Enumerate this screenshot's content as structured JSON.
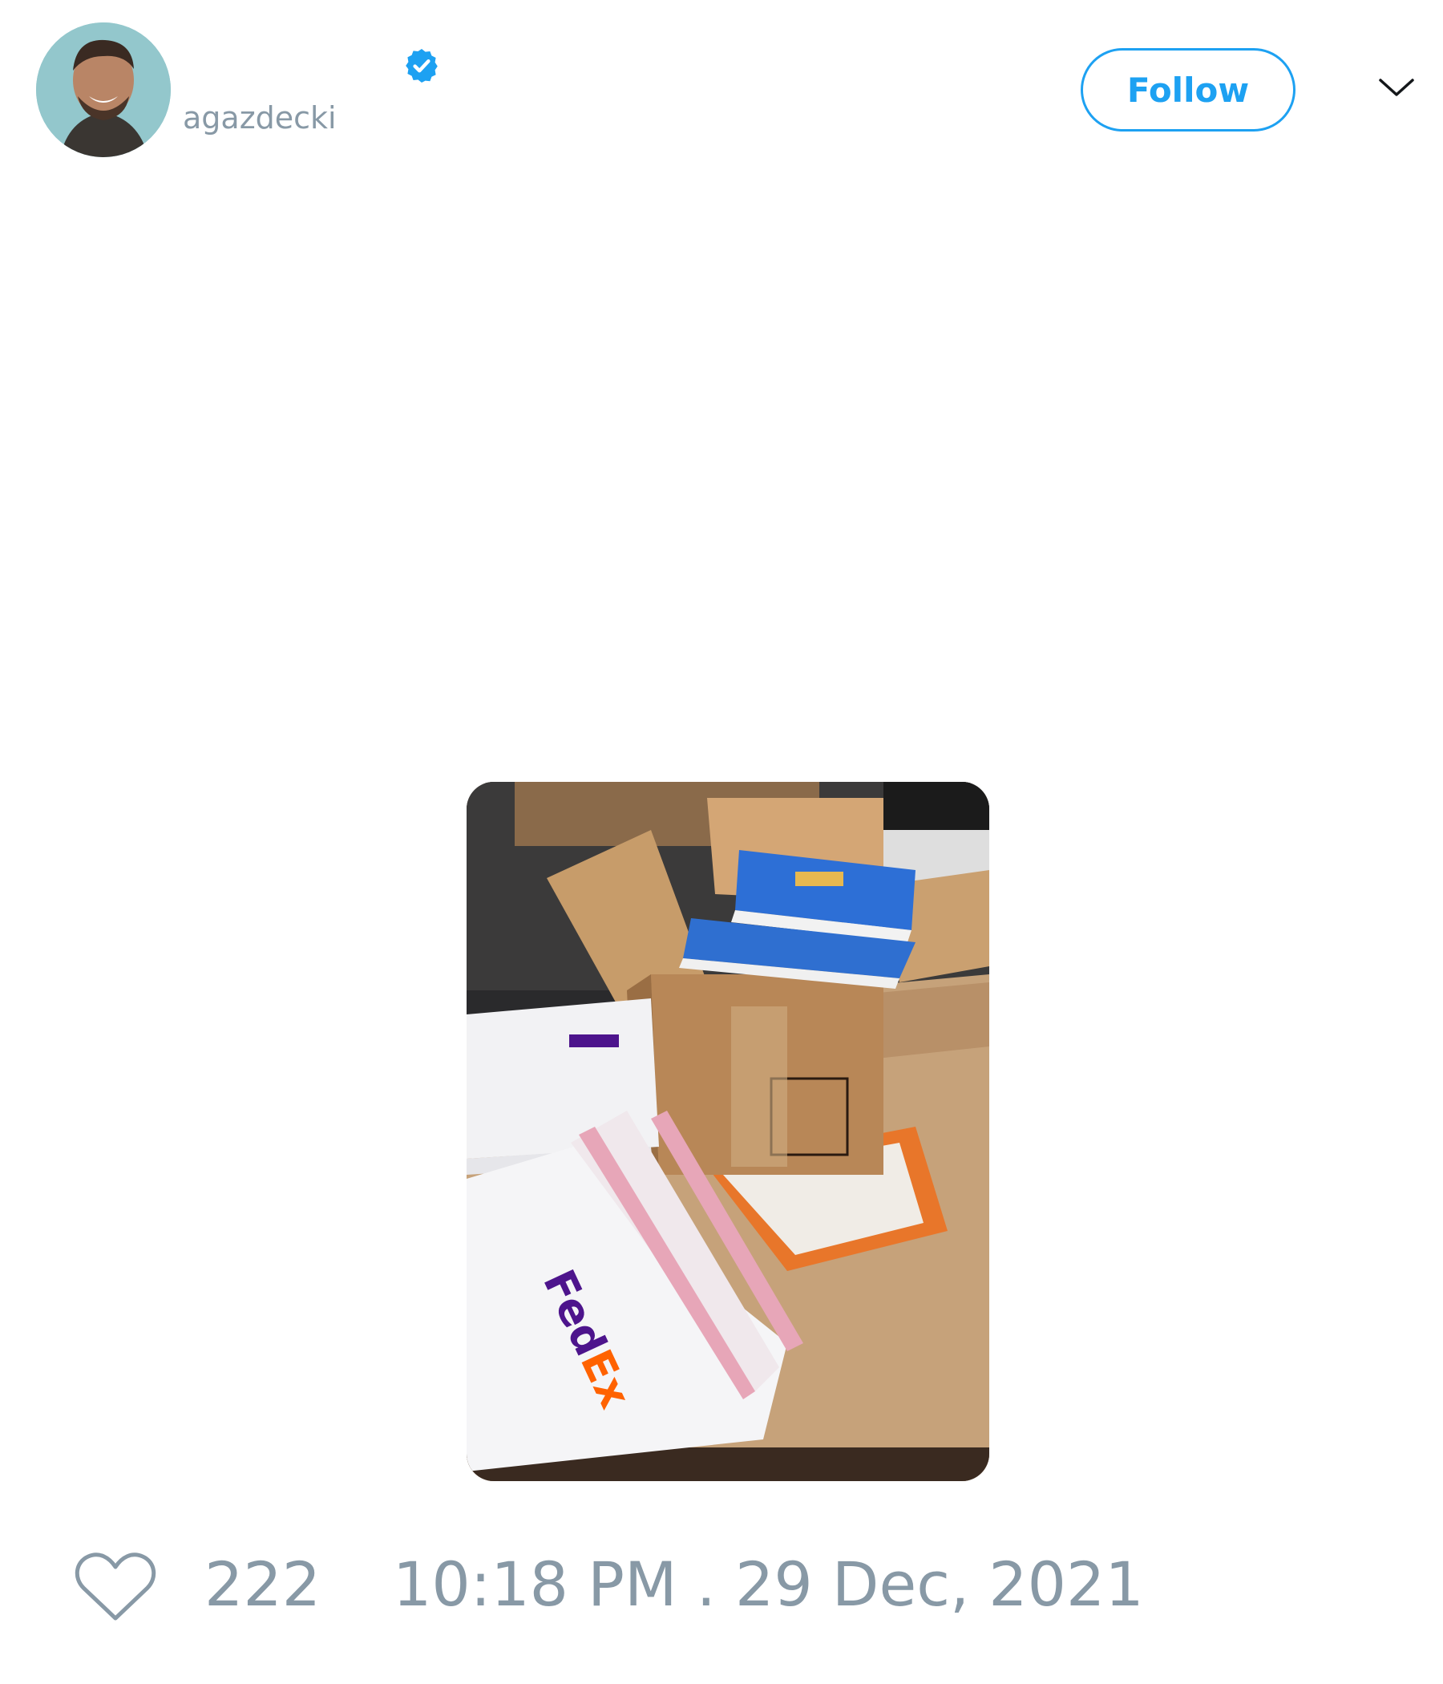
{
  "tweet": {
    "author": {
      "handle": "agazdecki",
      "verified": true,
      "avatar": "profile-photo"
    },
    "follow_label": "Follow",
    "menu_icon": "chevron-down-icon",
    "media": {
      "alt": "photo-of-shipping-box-with-books-and-fedex-mailers"
    },
    "like_icon": "heart-icon",
    "like_count": "222",
    "timestamp": "10:18 PM . 29 Dec, 2021"
  },
  "colors": {
    "accent": "#1da1f2",
    "muted_text": "#8899a6"
  }
}
